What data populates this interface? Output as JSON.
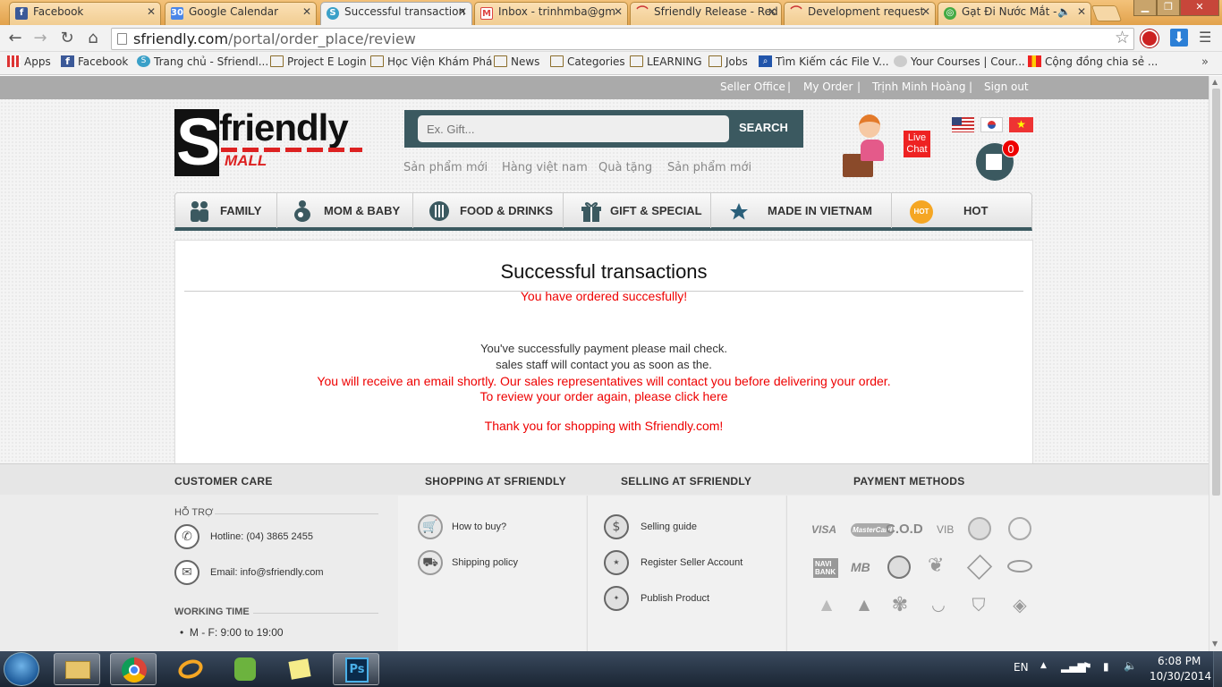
{
  "browser": {
    "tabs": [
      {
        "label": "Facebook",
        "icon": "facebook-icon",
        "color": "#3b5998"
      },
      {
        "label": "Google Calendar",
        "icon": "calendar-icon",
        "color": "#4a86e8"
      },
      {
        "label": "Successful transaction",
        "icon": "sfriendly-icon",
        "color": "#3aa0c8",
        "active": true
      },
      {
        "label": "Inbox - trinhmba@gm",
        "icon": "gmail-icon",
        "color": "#d44"
      },
      {
        "label": "Sfriendly Release - Red",
        "icon": "redmine-icon",
        "color": "#c33"
      },
      {
        "label": "Development request",
        "icon": "redmine-icon",
        "color": "#c33"
      },
      {
        "label": "Gạt Đi Nước Mắt -",
        "icon": "chrome-icon",
        "color": "#4a4"
      }
    ],
    "url_host": "sfriendly.com",
    "url_path": "/portal/order_place/review",
    "bookmarks": [
      {
        "label": "Apps",
        "icon": "apps-icon"
      },
      {
        "label": "Facebook",
        "icon": "facebook-icon"
      },
      {
        "label": "Trang chủ - Sfriendl...",
        "icon": "sfriendly-icon"
      },
      {
        "label": "Project E Login",
        "icon": "folder-icon"
      },
      {
        "label": "Học Viện Khám Phá",
        "icon": "folder-icon"
      },
      {
        "label": "News",
        "icon": "folder-icon"
      },
      {
        "label": "Categories",
        "icon": "folder-icon"
      },
      {
        "label": "LEARNING",
        "icon": "folder-icon"
      },
      {
        "label": "Jobs",
        "icon": "folder-icon"
      },
      {
        "label": "Tìm Kiếm các File V...",
        "icon": "search-icon"
      },
      {
        "label": "Your Courses | Cour...",
        "icon": "coursera-icon"
      },
      {
        "label": "Cộng đồng chia sẻ ...",
        "icon": "chart-icon"
      }
    ]
  },
  "site": {
    "toplinks": [
      "Seller Office",
      "My Order",
      "Trịnh Minh Hoàng",
      "Sign out"
    ],
    "logo_main": "friendly",
    "logo_s": "S",
    "logo_sub": "MALL",
    "search_placeholder": "Ex. Gift...",
    "search_button": "SEARCH",
    "sublinks": [
      "Sản phẩm mới",
      "Hàng việt nam",
      "Quà tặng",
      "Sản phẩm mới"
    ],
    "live_chat": "Live Chat",
    "cart_count": "0",
    "nav": [
      "FAMILY",
      "MOM & BABY",
      "FOOD & DRINKS",
      "GIFT & SPECIAL",
      "MADE IN VIETNAM",
      "HOT"
    ],
    "hot_badge": "HOT"
  },
  "content": {
    "title": "Successful transactions",
    "ordered": "You have ordered succesfully!",
    "line1": "You've successfully payment please mail check.",
    "line2": "sales staff will contact you as soon as the.",
    "line3": "You will receive an email shortly. Our sales representatives will contact you before delivering your order.",
    "line4": "To review your order again, please click here",
    "thanks": "Thank you for shopping with Sfriendly.com!"
  },
  "footer": {
    "headings": [
      "CUSTOMER CARE",
      "SHOPPING AT SFRIENDLY",
      "SELLING AT SFRIENDLY",
      "PAYMENT METHODS"
    ],
    "support_title": "HỖ TRỢ",
    "hotline": "Hotline: (04) 3865 2455",
    "email": "Email: info@sfriendly.com",
    "working_title": "WORKING TIME",
    "working_hours": "M - F: 9:00 to 19:00",
    "shopping_links": [
      "How to buy?",
      "Shipping policy"
    ],
    "selling_links": [
      "Selling guide",
      "Register Seller Account",
      "Publish Product"
    ],
    "payment_labels": [
      "VISA",
      "MasterCard",
      "C.O.D",
      "VIB",
      "NAVI BANK",
      "MB"
    ]
  },
  "taskbar": {
    "lang": "EN",
    "time": "6:08 PM",
    "date": "10/30/2014"
  },
  "colors": {
    "accent": "#3b5960",
    "alert_red": "#e00000",
    "cart_badge": "#e00000"
  }
}
